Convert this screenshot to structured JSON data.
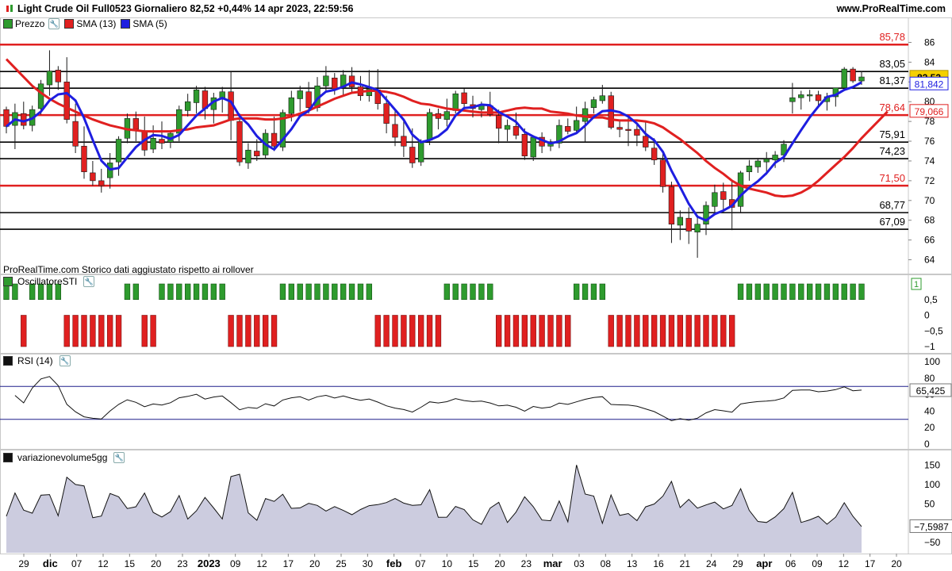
{
  "header": {
    "title": "Light Crude Oil Full0523 Giornaliero 82,52 +0,44% 14 apr 2023, 22:59:56",
    "site": "www.ProRealTime.com"
  },
  "price_panel": {
    "legend": [
      {
        "label": "Prezzo",
        "color": "#2e9b2e",
        "icon": "candle-icon"
      },
      {
        "label": "SMA (13)",
        "color": "#e02020",
        "icon": "square-icon"
      },
      {
        "label": "SMA (5)",
        "color": "#1e1ee0",
        "icon": "square-icon"
      }
    ],
    "watermark": "ProRealTime.com Storico dati aggiustato rispetto ai rollover",
    "current_price": "82,52",
    "sma5_value": "81,842",
    "sma13_value": "79,066",
    "levels": [
      {
        "label": "85,78",
        "value": 85.78,
        "color": "#e02020"
      },
      {
        "label": "83,05",
        "value": 83.05,
        "color": "#000000"
      },
      {
        "label": "81,37",
        "value": 81.37,
        "color": "#000000"
      },
      {
        "label": "78,64",
        "value": 78.64,
        "color": "#e02020"
      },
      {
        "label": "75,91",
        "value": 75.91,
        "color": "#000000"
      },
      {
        "label": "74,23",
        "value": 74.23,
        "color": "#000000"
      },
      {
        "label": "71,50",
        "value": 71.5,
        "color": "#e02020"
      },
      {
        "label": "68,77",
        "value": 68.77,
        "color": "#000000"
      },
      {
        "label": "67,09",
        "value": 67.09,
        "color": "#000000"
      }
    ],
    "y_ticks": [
      "86",
      "84",
      "82",
      "80",
      "78",
      "76",
      "74",
      "72",
      "70",
      "68",
      "66",
      "64"
    ]
  },
  "sti_panel": {
    "legend": "OscillatoreSTI",
    "top_value": "1",
    "y_ticks": [
      "0,5",
      "0",
      "−0,5",
      "−1"
    ]
  },
  "rsi_panel": {
    "legend": "RSI (14)",
    "value": "65,425",
    "y_ticks": [
      "100",
      "80",
      "60",
      "40",
      "20",
      "0"
    ]
  },
  "vol_panel": {
    "legend": "variazionevolume5gg",
    "value": "−7,5987",
    "y_ticks": [
      "150",
      "100",
      "50",
      "0",
      "−50"
    ]
  },
  "x_axis": {
    "labels": [
      {
        "label": "29",
        "bold": false
      },
      {
        "label": "dic",
        "bold": true
      },
      {
        "label": "07",
        "bold": false
      },
      {
        "label": "12",
        "bold": false
      },
      {
        "label": "15",
        "bold": false
      },
      {
        "label": "20",
        "bold": false
      },
      {
        "label": "23",
        "bold": false
      },
      {
        "label": "2023",
        "bold": true
      },
      {
        "label": "09",
        "bold": false
      },
      {
        "label": "12",
        "bold": false
      },
      {
        "label": "17",
        "bold": false
      },
      {
        "label": "20",
        "bold": false
      },
      {
        "label": "25",
        "bold": false
      },
      {
        "label": "30",
        "bold": false
      },
      {
        "label": "feb",
        "bold": true
      },
      {
        "label": "07",
        "bold": false
      },
      {
        "label": "10",
        "bold": false
      },
      {
        "label": "15",
        "bold": false
      },
      {
        "label": "20",
        "bold": false
      },
      {
        "label": "23",
        "bold": false
      },
      {
        "label": "mar",
        "bold": true
      },
      {
        "label": "03",
        "bold": false
      },
      {
        "label": "08",
        "bold": false
      },
      {
        "label": "13",
        "bold": false
      },
      {
        "label": "16",
        "bold": false
      },
      {
        "label": "21",
        "bold": false
      },
      {
        "label": "24",
        "bold": false
      },
      {
        "label": "29",
        "bold": false
      },
      {
        "label": "apr",
        "bold": true
      },
      {
        "label": "06",
        "bold": false
      },
      {
        "label": "09",
        "bold": false
      },
      {
        "label": "12",
        "bold": false
      },
      {
        "label": "17",
        "bold": false
      },
      {
        "label": "20",
        "bold": false
      }
    ]
  },
  "chart_data": {
    "type": "candlestick",
    "ylim": [
      63,
      87
    ],
    "candles": [
      [
        79.2,
        79.5,
        76.8,
        77.5
      ],
      [
        77.6,
        79.8,
        75.2,
        78.9
      ],
      [
        78.8,
        80.0,
        77.2,
        77.6
      ],
      [
        77.6,
        79.6,
        77.0,
        79.2
      ],
      [
        79.3,
        82.2,
        78.7,
        81.8
      ],
      [
        81.7,
        85.2,
        80.6,
        83.1
      ],
      [
        83.2,
        83.6,
        81.2,
        82.0
      ],
      [
        82.0,
        84.5,
        77.8,
        78.2
      ],
      [
        78.0,
        79.8,
        74.8,
        75.5
      ],
      [
        75.5,
        77.5,
        72.2,
        72.9
      ],
      [
        72.8,
        74.0,
        71.5,
        72.0
      ],
      [
        72.0,
        73.2,
        70.8,
        71.5
      ],
      [
        72.3,
        74.8,
        71.2,
        73.8
      ],
      [
        73.9,
        76.5,
        72.5,
        76.2
      ],
      [
        76.3,
        78.8,
        75.8,
        78.3
      ],
      [
        78.3,
        79.0,
        76.0,
        77.2
      ],
      [
        77.0,
        78.5,
        74.5,
        75.1
      ],
      [
        75.2,
        77.6,
        74.8,
        76.3
      ],
      [
        76.2,
        78.0,
        75.2,
        75.8
      ],
      [
        75.9,
        77.1,
        75.3,
        76.8
      ],
      [
        76.8,
        79.6,
        76.0,
        79.2
      ],
      [
        79.1,
        80.8,
        78.5,
        80.0
      ],
      [
        79.9,
        81.6,
        78.8,
        81.2
      ],
      [
        81.1,
        81.5,
        78.2,
        79.3
      ],
      [
        79.2,
        80.9,
        77.8,
        80.4
      ],
      [
        80.3,
        81.5,
        78.9,
        81.0
      ],
      [
        81.0,
        83.0,
        76.1,
        78.1
      ],
      [
        78.0,
        78.8,
        73.5,
        73.9
      ],
      [
        73.8,
        75.8,
        73.2,
        75.1
      ],
      [
        75.0,
        76.2,
        74.0,
        74.5
      ],
      [
        74.6,
        77.2,
        74.2,
        76.8
      ],
      [
        76.8,
        78.5,
        75.0,
        75.5
      ],
      [
        75.4,
        79.2,
        75.0,
        78.9
      ],
      [
        78.8,
        81.1,
        78.0,
        80.4
      ],
      [
        80.3,
        81.6,
        79.0,
        81.1
      ],
      [
        81.0,
        82.0,
        78.8,
        79.4
      ],
      [
        79.4,
        82.5,
        79.0,
        81.6
      ],
      [
        81.6,
        83.6,
        81.0,
        82.6
      ],
      [
        82.4,
        82.9,
        80.7,
        81.3
      ],
      [
        81.4,
        83.2,
        80.5,
        82.7
      ],
      [
        82.6,
        83.5,
        80.8,
        81.5
      ],
      [
        81.5,
        82.6,
        80.1,
        80.6
      ],
      [
        80.6,
        83.2,
        80.0,
        81.3
      ],
      [
        81.2,
        83.3,
        79.2,
        79.8
      ],
      [
        79.8,
        80.6,
        76.8,
        77.8
      ],
      [
        77.7,
        79.2,
        75.5,
        76.4
      ],
      [
        76.5,
        78.3,
        74.4,
        75.5
      ],
      [
        75.4,
        77.3,
        73.3,
        73.8
      ],
      [
        73.9,
        76.2,
        73.5,
        76.0
      ],
      [
        76.1,
        79.3,
        75.6,
        78.9
      ],
      [
        78.8,
        79.3,
        77.2,
        78.3
      ],
      [
        78.2,
        80.3,
        77.5,
        79.0
      ],
      [
        79.1,
        81.1,
        78.8,
        80.8
      ],
      [
        80.9,
        81.3,
        79.2,
        79.8
      ],
      [
        79.7,
        80.6,
        78.4,
        79.3
      ],
      [
        79.2,
        80.0,
        78.4,
        79.6
      ],
      [
        79.6,
        81.0,
        78.5,
        78.7
      ],
      [
        78.6,
        79.2,
        75.8,
        77.3
      ],
      [
        77.2,
        78.2,
        76.0,
        77.6
      ],
      [
        77.5,
        78.9,
        76.2,
        76.6
      ],
      [
        76.7,
        77.3,
        74.1,
        74.5
      ],
      [
        74.4,
        76.6,
        74.0,
        76.4
      ],
      [
        76.4,
        76.9,
        74.8,
        75.5
      ],
      [
        75.5,
        76.2,
        75.0,
        75.9
      ],
      [
        75.8,
        78.2,
        75.3,
        77.6
      ],
      [
        77.5,
        78.3,
        76.7,
        77.0
      ],
      [
        77.1,
        79.5,
        76.9,
        78.1
      ],
      [
        78.0,
        80.0,
        75.9,
        79.3
      ],
      [
        79.4,
        80.5,
        78.8,
        80.2
      ],
      [
        80.1,
        81.7,
        79.8,
        80.6
      ],
      [
        80.6,
        81.0,
        77.2,
        77.4
      ],
      [
        77.4,
        78.1,
        76.4,
        77.2
      ],
      [
        77.2,
        78.5,
        75.5,
        77.1
      ],
      [
        77.2,
        77.9,
        75.5,
        76.6
      ],
      [
        76.5,
        78.1,
        75.0,
        75.4
      ],
      [
        75.3,
        76.3,
        73.6,
        74.1
      ],
      [
        74.1,
        74.9,
        70.8,
        71.4
      ],
      [
        71.4,
        71.9,
        65.7,
        67.6
      ],
      [
        67.5,
        69.0,
        66.0,
        68.3
      ],
      [
        68.2,
        69.3,
        65.6,
        66.9
      ],
      [
        66.8,
        68.5,
        64.2,
        67.6
      ],
      [
        67.6,
        69.9,
        66.5,
        69.5
      ],
      [
        69.4,
        71.6,
        68.5,
        70.8
      ],
      [
        70.9,
        71.8,
        68.7,
        70.1
      ],
      [
        70.1,
        71.9,
        67.0,
        69.3
      ],
      [
        69.4,
        73.0,
        68.7,
        72.8
      ],
      [
        72.9,
        74.1,
        72.0,
        73.5
      ],
      [
        73.4,
        74.3,
        72.8,
        74.0
      ],
      [
        73.9,
        74.9,
        72.6,
        74.2
      ],
      [
        74.1,
        75.0,
        73.3,
        74.6
      ],
      [
        74.6,
        76.1,
        73.9,
        75.7
      ],
      [
        80.0,
        81.9,
        78.8,
        80.4
      ],
      [
        80.4,
        81.1,
        79.2,
        80.7
      ],
      [
        80.7,
        81.2,
        80.0,
        80.7
      ],
      [
        80.7,
        81.1,
        79.4,
        80.1
      ],
      [
        80.0,
        80.9,
        79.1,
        80.5
      ],
      [
        80.5,
        81.3,
        79.5,
        81.4
      ],
      [
        81.4,
        83.5,
        81.2,
        83.3
      ],
      [
        83.3,
        83.5,
        81.9,
        82.1
      ],
      [
        82.1,
        83.1,
        81.7,
        82.5
      ]
    ],
    "sma13": [
      84.3,
      83.4,
      82.5,
      81.6,
      80.9,
      80.3,
      79.8,
      79.4,
      79.0,
      78.6,
      78.2,
      77.9,
      77.6,
      77.4,
      77.2,
      77.1,
      77.0,
      77.0,
      77.0,
      77.0,
      77.1,
      77.2,
      77.4,
      77.5,
      77.6,
      77.9,
      78.2,
      78.3,
      78.3,
      78.3,
      78.2,
      78.2,
      78.3,
      78.5,
      78.8,
      79.1,
      79.5,
      79.9,
      80.3,
      80.6,
      80.9,
      81.0,
      81.1,
      81.1,
      81.0,
      80.8,
      80.5,
      80.1,
      79.8,
      79.7,
      79.5,
      79.3,
      79.2,
      79.1,
      79.0,
      78.9,
      78.9,
      78.9,
      79.1,
      79.3,
      79.4,
      79.3,
      79.3,
      79.0,
      78.9,
      78.8,
      78.6,
      78.5,
      78.4,
      78.4,
      78.2,
      78.1,
      78.1,
      78.1,
      78.0,
      77.8,
      77.4,
      76.8,
      76.2,
      75.5,
      74.8,
      74.0,
      73.3,
      72.7,
      72.0,
      71.5,
      71.2,
      71.0,
      70.8,
      70.5,
      70.4,
      70.5,
      70.8,
      71.3,
      72.0,
      72.8,
      73.6,
      74.4,
      75.3,
      76.3,
      77.2,
      78.1,
      79.0
    ]
  }
}
